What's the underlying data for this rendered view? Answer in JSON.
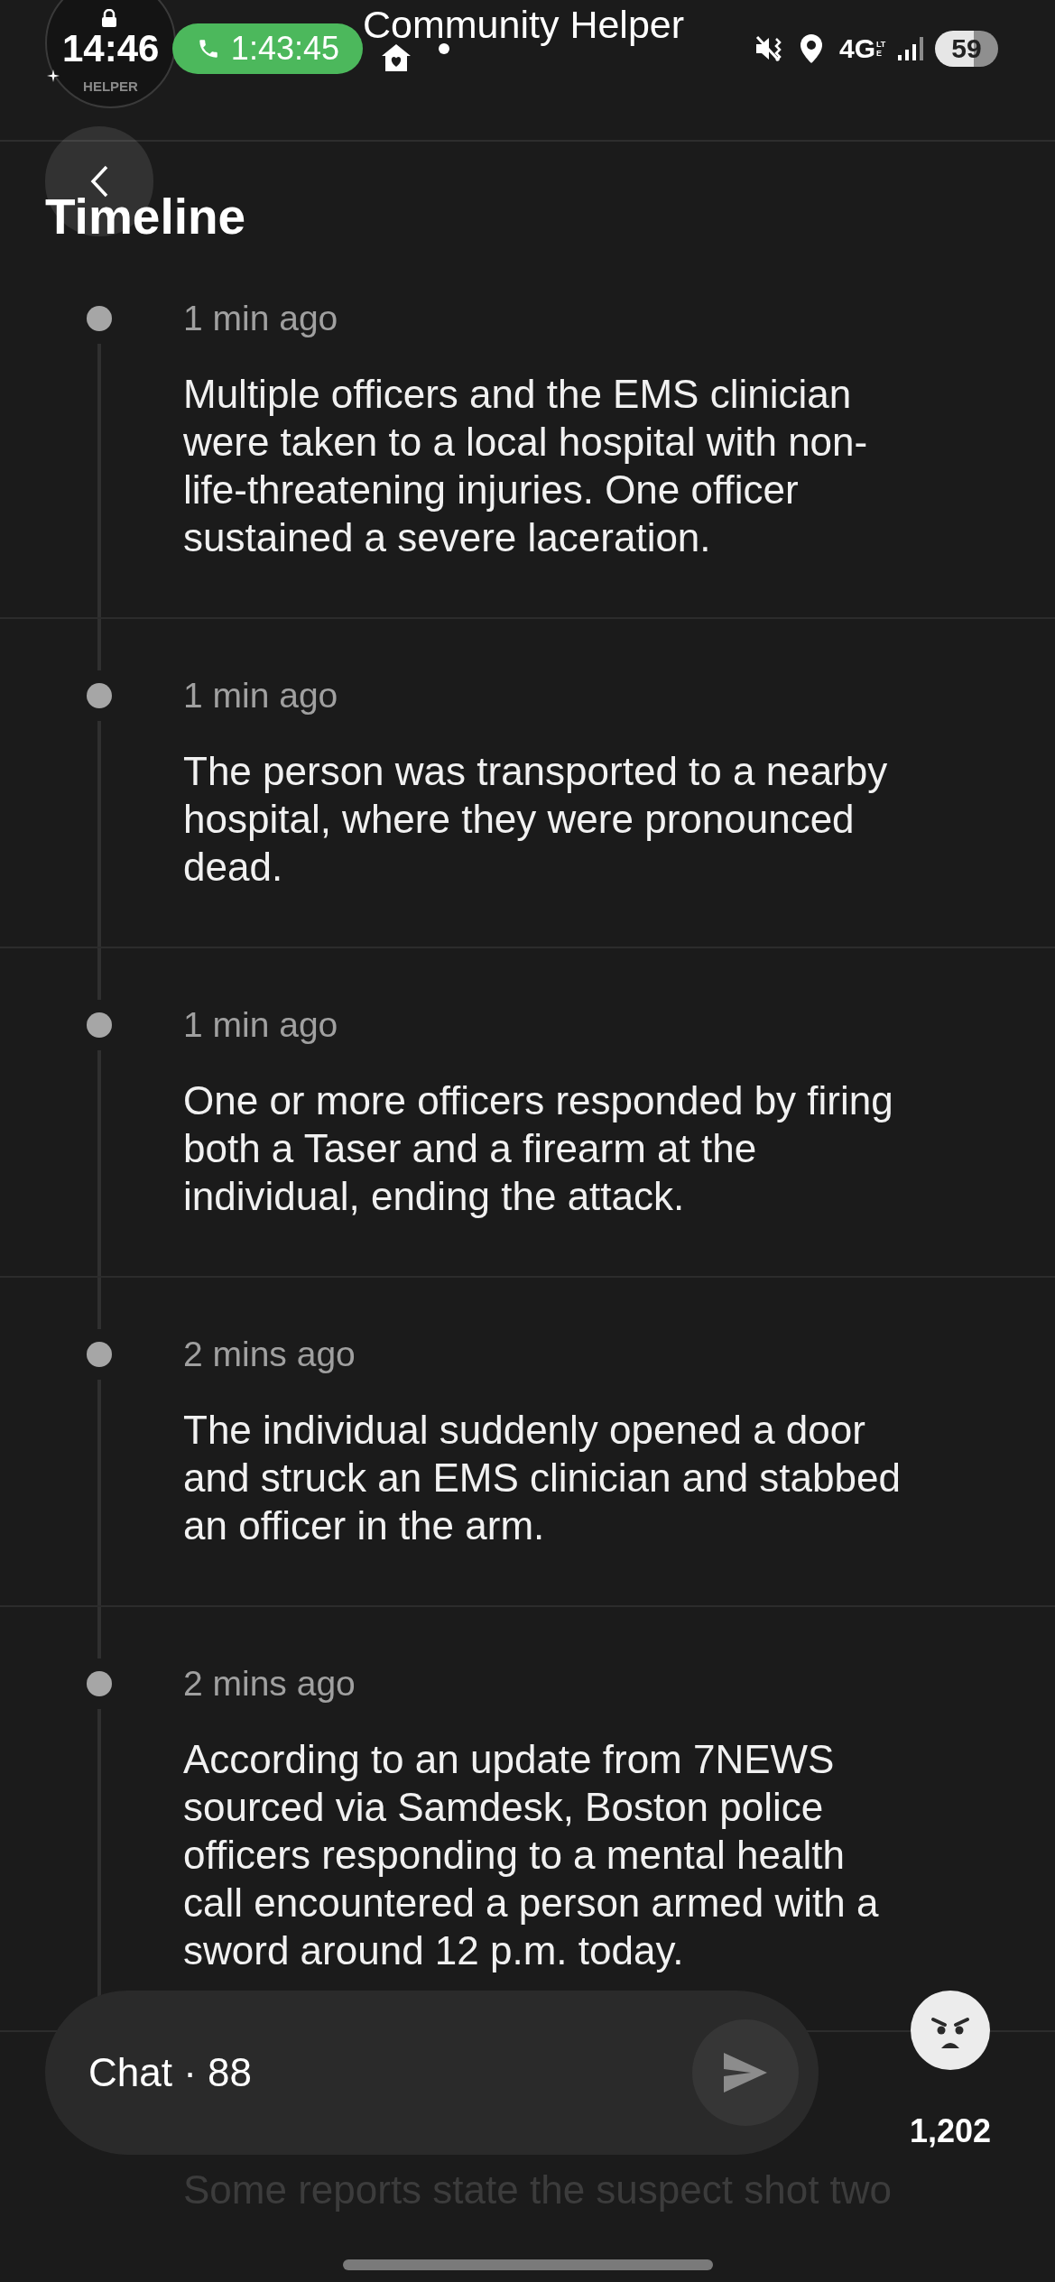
{
  "status_bar": {
    "time": "14:46",
    "call_timer": "1:43:45",
    "network": "4G",
    "network_detail": "LTE",
    "battery": "59"
  },
  "app_logo": {
    "text": "HELPER"
  },
  "app_title": "Community Helper",
  "page_title": "Timeline",
  "timeline": [
    {
      "time": "1 min ago",
      "text": "Multiple officers and the EMS clinician were taken to a local hospital with non-life-threatening injuries. One officer sustained a severe laceration."
    },
    {
      "time": "1 min ago",
      "text": "The person was transported to a nearby hospital, where they were pronounced dead."
    },
    {
      "time": "1 min ago",
      "text": "One or more officers responded by firing both a Taser and a firearm at the individual, ending the attack."
    },
    {
      "time": "2 mins ago",
      "text": "The individual suddenly opened a door and struck an EMS clinician and stabbed an officer in the arm."
    },
    {
      "time": "2 mins ago",
      "text": "According to an update from 7NEWS sourced via Samdesk, Boston police officers responding to a mental health call encountered a person armed with a sword around 12 p.m. today."
    }
  ],
  "partial_entry": {
    "text": "Some reports state the suspect shot two"
  },
  "chat_bar": {
    "label": "Chat · 88"
  },
  "reaction": {
    "count": "1,202"
  }
}
